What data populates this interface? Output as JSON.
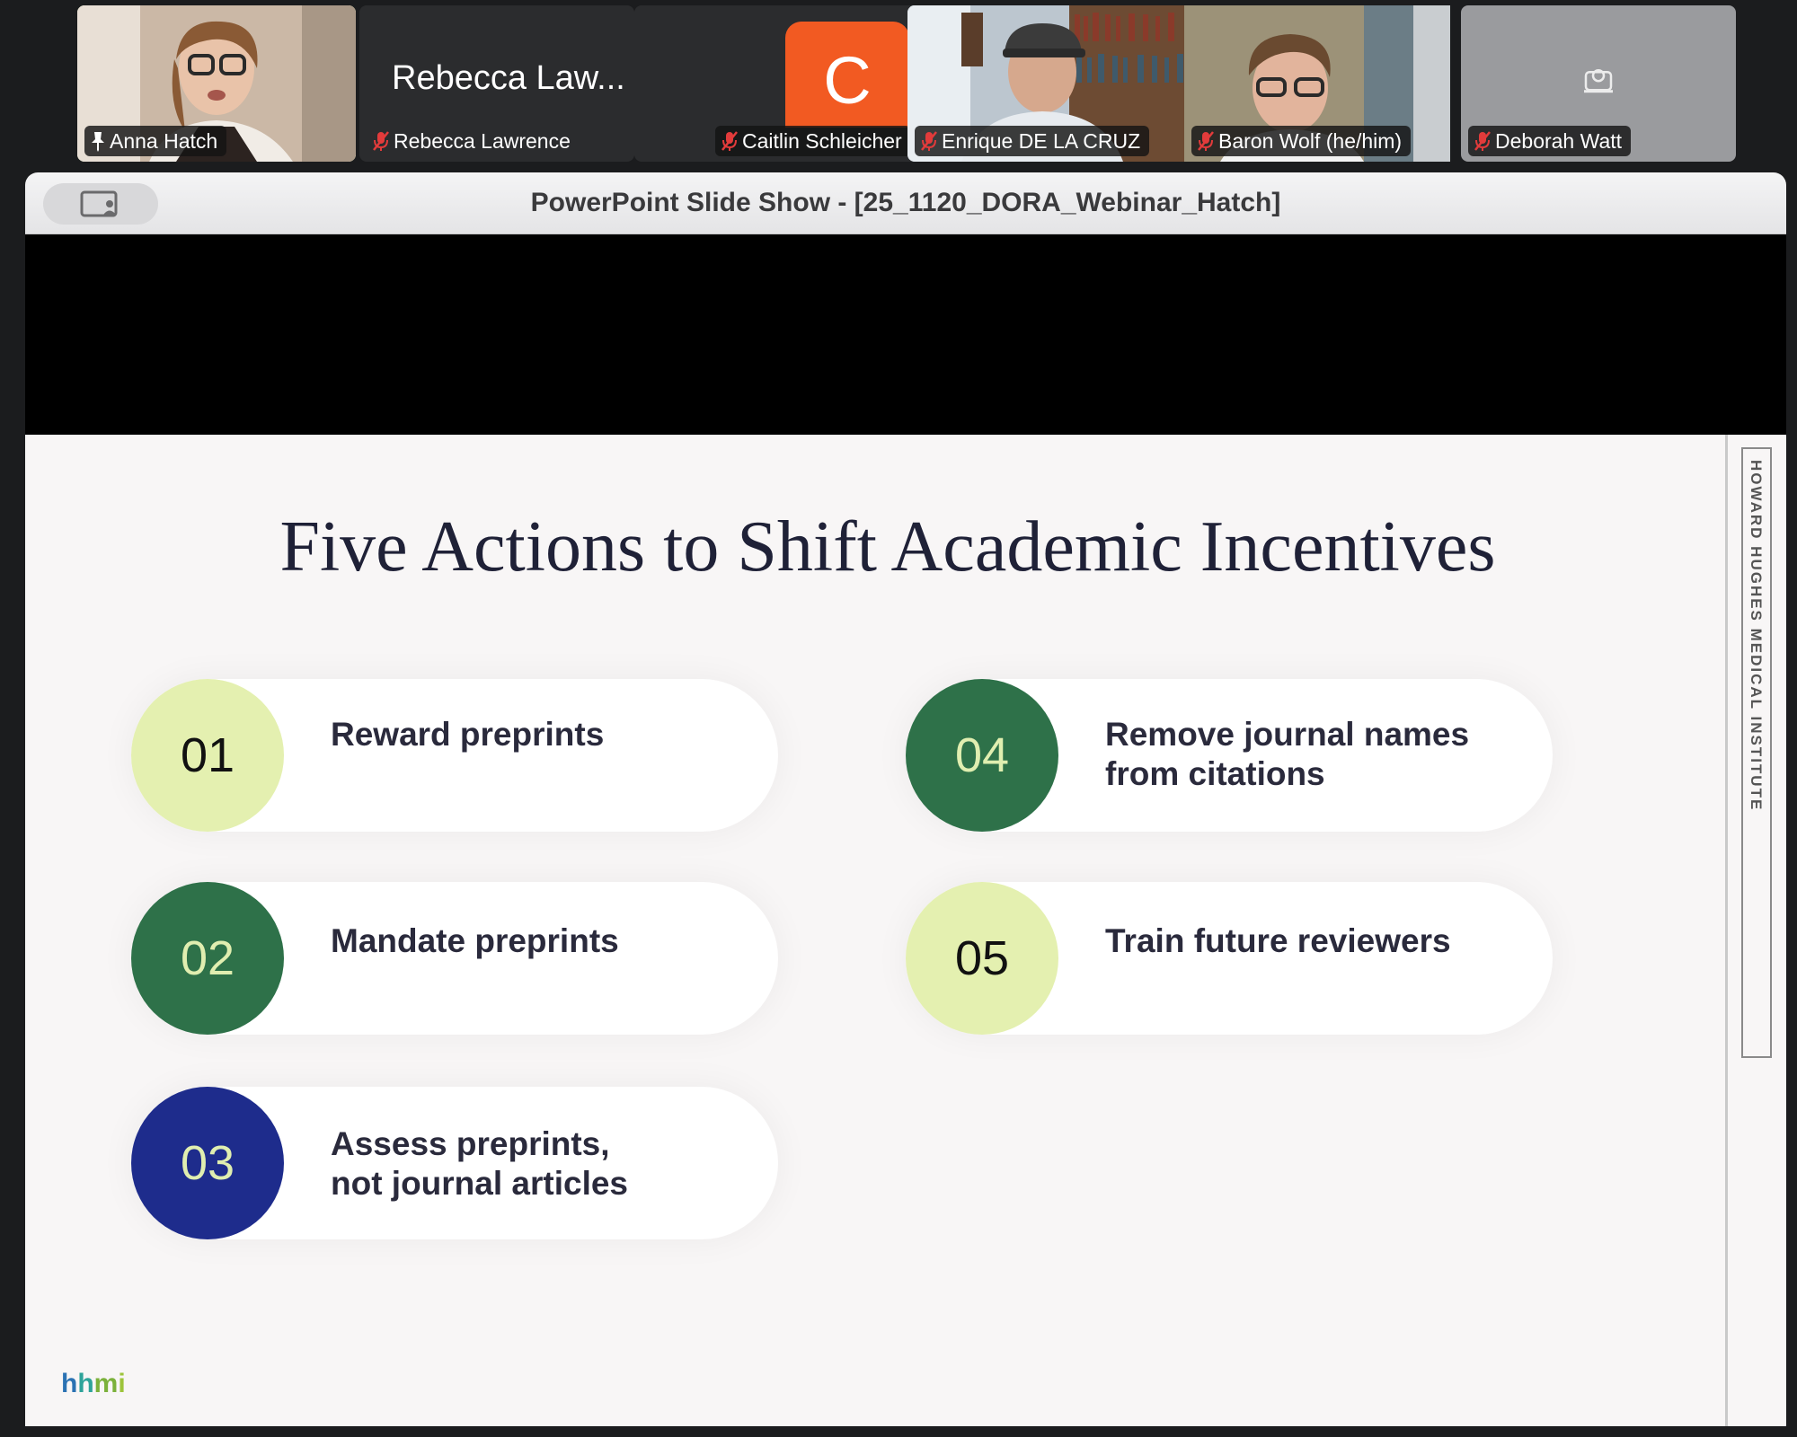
{
  "participants": [
    {
      "name": "Anna Hatch",
      "pinned": true,
      "active": true
    },
    {
      "name": "Rebecca Lawrence",
      "display_name": "Rebecca Law...",
      "muted": true
    },
    {
      "name": "Caitlin Schleicher",
      "avatar_letter": "C",
      "muted": true
    },
    {
      "name": "Enrique DE LA CRUZ",
      "muted": true
    },
    {
      "name": "Baron Wolf (he/him)",
      "muted": true
    },
    {
      "name": "Deborah Watt",
      "muted": true,
      "camera_off_icon": "camera-off-icon"
    }
  ],
  "share": {
    "window_title": "PowerPoint Slide Show - [25_1120_DORA_Webinar_Hatch]"
  },
  "slide": {
    "title": "Five Actions to Shift Academic Incentives",
    "actions": [
      {
        "number": "01",
        "line1": "Reward preprints",
        "line2": ""
      },
      {
        "number": "02",
        "line1": "Mandate preprints",
        "line2": ""
      },
      {
        "number": "03",
        "line1": "Assess preprints,",
        "line2": "not journal articles"
      },
      {
        "number": "04",
        "line1": "Remove journal names",
        "line2": "from citations"
      },
      {
        "number": "05",
        "line1": "Train future reviewers",
        "line2": ""
      }
    ],
    "side_label": "HOWARD HUGHES MEDICAL INSTITUTE",
    "logo_letters": [
      "h",
      "h",
      "m",
      "i"
    ]
  },
  "colors": {
    "active_speaker": "#2ed158",
    "avatar_orange": "#f25a22",
    "circle_light": "#e4f0b0",
    "circle_green": "#2e7149",
    "circle_navy": "#1e2c8c"
  }
}
